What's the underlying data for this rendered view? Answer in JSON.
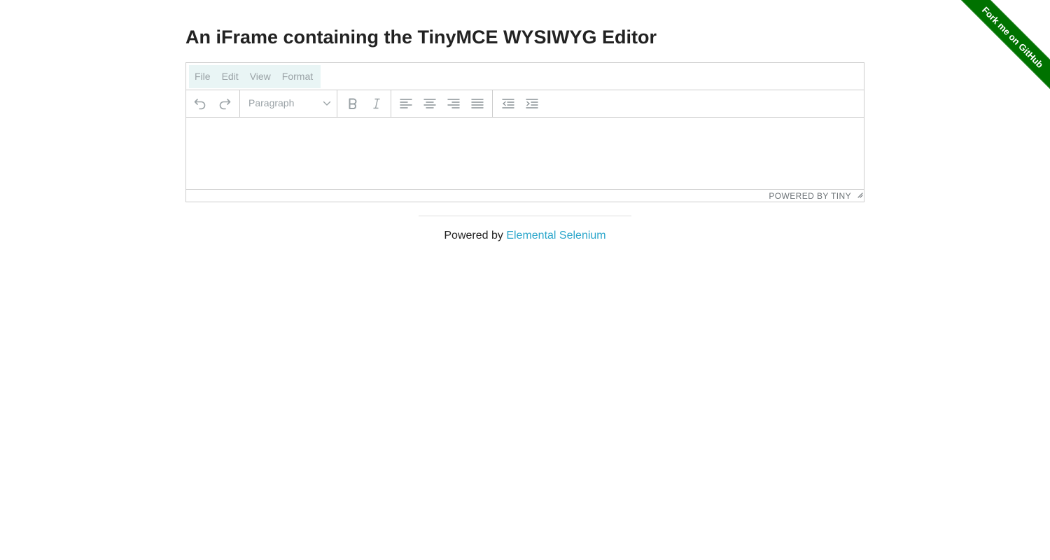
{
  "page": {
    "heading": "An iFrame containing the TinyMCE WYSIWYG Editor"
  },
  "editor": {
    "menubar": {
      "items": [
        {
          "label": "File"
        },
        {
          "label": "Edit"
        },
        {
          "label": "View"
        },
        {
          "label": "Format"
        }
      ]
    },
    "toolbar": {
      "block_format": "Paragraph",
      "icons": {
        "undo": "undo-icon",
        "redo": "redo-icon",
        "bold": "bold-icon",
        "italic": "italic-icon",
        "align_left": "align-left-icon",
        "align_center": "align-center-icon",
        "align_right": "align-right-icon",
        "align_justify": "align-justify-icon",
        "outdent": "outdent-icon",
        "indent": "indent-icon"
      }
    },
    "content": "",
    "statusbar": {
      "branding": "POWERED BY TINY"
    }
  },
  "footer": {
    "prefix": "Powered by",
    "link_text": "Elemental Selenium"
  },
  "ribbon": {
    "label": "Fork me on GitHub",
    "color": "#007200"
  },
  "colors": {
    "link": "#2ba6cb",
    "menu_highlight": "#e9f5f5",
    "disabled_text": "#9aa2a6"
  }
}
